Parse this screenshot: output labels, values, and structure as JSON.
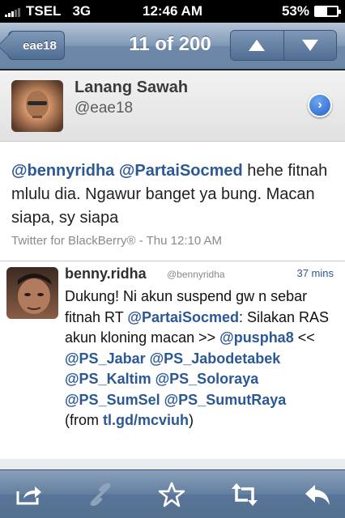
{
  "status_bar": {
    "carrier": "TSEL",
    "network": "3G",
    "time": "12:46 AM",
    "battery": "53%",
    "battery_level": 0.53
  },
  "nav": {
    "back_label": "eae18",
    "title": "11 of 200",
    "up_icon": "arrow-up-icon",
    "down_icon": "arrow-down-icon"
  },
  "profile": {
    "name": "Lanang Sawah",
    "handle": "@eae18"
  },
  "tweet": {
    "mention1": "@bennyridha",
    "mention2": "@PartaiSocmed",
    "text": " hehe fitnah mlulu dia. Ngawur banget ya bung. Macan siapa, sy siapa",
    "meta": "Twitter for BlackBerry® - Thu 12:10 AM"
  },
  "reply": {
    "name": "benny.ridha",
    "handle": "@bennyridha",
    "time": "37 mins",
    "t1": "Dukung! Ni akun suspend gw n sebar fitnah RT ",
    "m1": "@PartaiSocmed",
    "t2": ": Silakan RAS akun kloning macan >> ",
    "m2": "@puspha8",
    "t3": " << ",
    "m3": "@PS_Jabar",
    "m4": "@PS_Jabodetabek",
    "m5": "@PS_Kaltim",
    "m6": "@PS_Soloraya",
    "m7": "@PS_SumSel",
    "m8": "@PS_SumutRaya",
    "t4": "(from ",
    "link": "tl.gd/mcviuh",
    "t5": ")"
  },
  "toolbar": {
    "icons": [
      "share-icon",
      "link-icon",
      "star-icon",
      "retweet-icon",
      "reply-icon"
    ]
  },
  "colors": {
    "mention": "#2b5896",
    "navbar": "#6e88a9"
  }
}
